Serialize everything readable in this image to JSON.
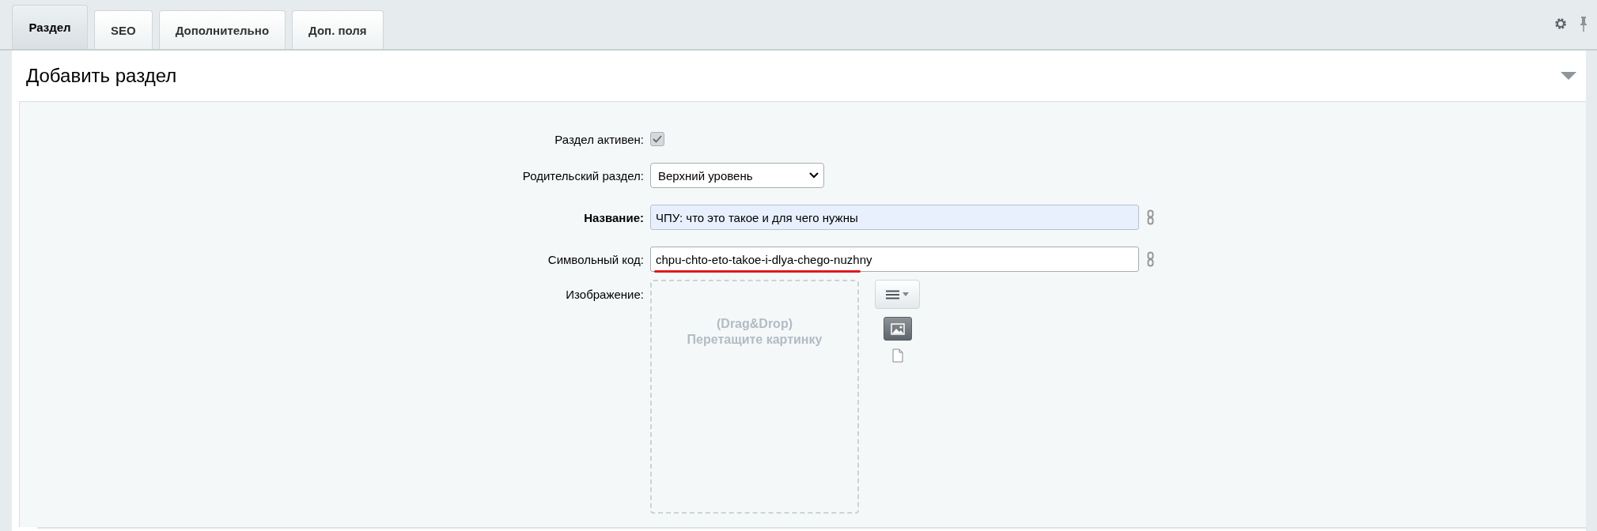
{
  "tabs": [
    {
      "label": "Раздел",
      "selected": true
    },
    {
      "label": "SEO",
      "selected": false
    },
    {
      "label": "Дополнительно",
      "selected": false
    },
    {
      "label": "Доп. поля",
      "selected": false
    }
  ],
  "panel": {
    "title": "Добавить раздел",
    "expanded": true
  },
  "fields": [
    {
      "kind": "checkbox",
      "label": "Раздел активен:",
      "checked": true
    },
    {
      "kind": "select",
      "label": "Родительский раздел:",
      "value": "Верхний уровень"
    },
    {
      "kind": "text",
      "label": "Название:",
      "required": true,
      "value": "ЧПУ: что это такое и для чего нужны",
      "highlighted": true,
      "underlined": false
    },
    {
      "kind": "text",
      "label": "Символьный код:",
      "required": false,
      "value": "chpu-chto-eto-takoe-i-dlya-chego-nuzhny",
      "highlighted": false,
      "underlined": true
    },
    {
      "kind": "image",
      "label": "Изображение:",
      "hint": "(Drag&Drop)",
      "prompt": "Перетащите картинку"
    }
  ]
}
